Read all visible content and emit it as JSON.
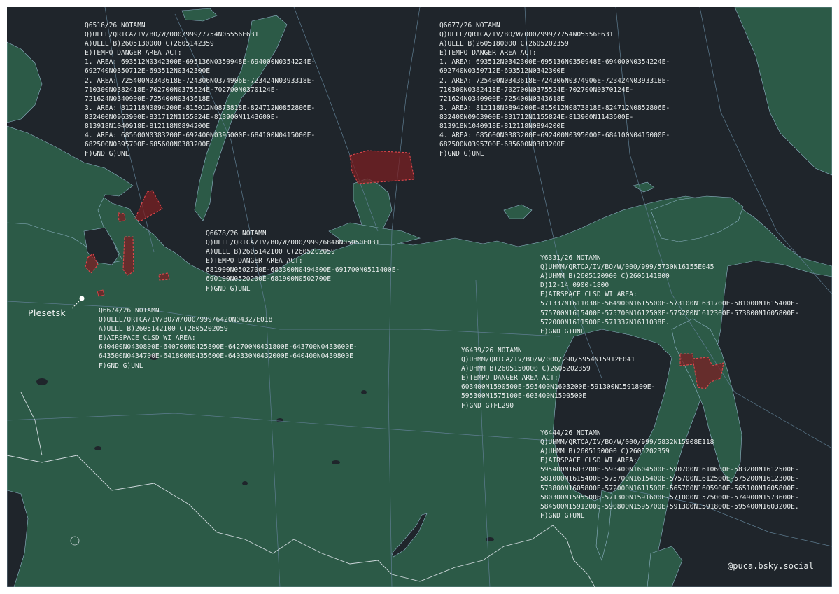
{
  "colors": {
    "sea": "#1f252b",
    "land": "#2c5a47",
    "coast": "#8fb4c6",
    "border": "#cfd8dc",
    "firline": "#5f7e92",
    "zone_fill": "#7a1f23",
    "zone_stroke": "#e0474c",
    "text": "#e8ecec"
  },
  "place": {
    "name": "Plesetsk",
    "icon": "location-dot-icon"
  },
  "credit": "@puca.bsky.social",
  "notams": [
    {
      "id": "q6516",
      "lines": [
        "Q6516/26 NOTAMN",
        "Q)ULLL/QRTCA/IV/BO/W/000/999/7754N05556E631",
        "A)ULLL B)2605130000 C)2605142359",
        "E)TEMPO DANGER AREA ACT:",
        "1. AREA: 693512N0342300E-695136N0350948E-694000N0354224E-",
        "692740N0350712E-693512N0342300E",
        "2. AREA: 725400N0343618E-724306N0374906E-723424N0393318E-",
        "710300N0382418E-702700N0375524E-702700N0370124E-",
        "721624N0340900E-725400N0343618E",
        "3. AREA: 812118N0894200E-815012N0873818E-824712N0852806E-",
        "832400N0963900E-831712N1155824E-813900N1143600E-",
        "813918N1040918E-812118N0894200E",
        "4. AREA: 685600N0383200E-692400N0395000E-684100N0415000E-",
        "682500N0395700E-685600N0383200E",
        "F)GND G)UNL"
      ]
    },
    {
      "id": "q6677",
      "lines": [
        "Q6677/26 NOTAMN",
        "Q)ULLL/QRTCA/IV/BO/W/000/999/7754N05556E631",
        "A)ULLL B)2605180000 C)2605202359",
        "E)TEMPO DANGER AREA ACT:",
        "1. AREA: 693512N0342300E-695136N0350948E-694000N0354224E-",
        "692740N0350712E-693512N0342300E",
        "2. AREA: 725400N0343618E-724306N0374906E-723424N0393318E-",
        "710300N0382418E-702700N0375524E-702700N0370124E-",
        "721624N0340900E-725400N0343618E",
        "3. AREA: 812118N0894200E-815012N0873818E-824712N0852806E-",
        "832400N0963900E-831712N1155824E-813900N1143600E-",
        "813918N1040918E-812118N0894200E",
        "4. AREA: 685600N0383200E-692400N0395000E-684100N0415000E-",
        "682500N0395700E-685600N0383200E",
        "F)GND G)UNL"
      ]
    },
    {
      "id": "q6678",
      "lines": [
        "Q6678/26 NOTAMN",
        "Q)ULLL/QRTCA/IV/BO/W/000/999/6848N05050E031",
        "A)ULLL B)2605142100 C)2605202059",
        "E)TEMPO DANGER AREA ACT:",
        "681900N0502700E-683300N0494800E-691700N0511400E-",
        "690100N0520200E-681900N0502700E",
        "F)GND G)UNL"
      ]
    },
    {
      "id": "q6674",
      "lines": [
        "Q6674/26 NOTAMN",
        "Q)ULLL/QRTCA/IV/BO/W/000/999/6420N04327E018",
        "A)ULLL B)2605142100 C)2605202059",
        "E)AIRSPACE CLSD WI AREA:",
        "640400N0430800E-640700N0425800E-642700N0431800E-643700N0433600E-",
        "643500N0434700E-641800N0435600E-640330N0432000E-640400N0430800E",
        "F)GND G)UNL"
      ]
    },
    {
      "id": "y6331",
      "lines": [
        "Y6331/26 NOTAMN",
        "Q)UHMM/QRTCA/IV/BO/W/000/999/5730N16155E045",
        "A)UHMM B)2605120900 C)2605141800",
        "D)12-14 0900-1800",
        "E)AIRSPACE CLSD WI AREA:",
        "571337N1611038E-564900N1615500E-573100N1631700E-581000N1615400E-",
        "575700N1615400E-575700N1612500E-575200N1612300E-573800N1605800E-",
        "572000N1611500E-571337N1611038E.",
        "F)GND G)UNL"
      ]
    },
    {
      "id": "y6439",
      "lines": [
        "Y6439/26 NOTAMN",
        "Q)UHMM/QRTCA/IV/BO/W/000/290/5954N15912E041",
        "A)UHMM B)2605150000 C)2605202359",
        "E)TEMPO DANGER AREA ACT:",
        "603400N1590500E-595400N1603200E-591300N1591800E-",
        "595300N1575100E-603400N1590500E",
        "F)GND G)FL290"
      ]
    },
    {
      "id": "y6444",
      "lines": [
        "Y6444/26 NOTAMN",
        "Q)UHMM/QRTCA/IV/BO/W/000/999/5832N15908E118",
        "A)UHMM B)2605150000 C)2605202359",
        "E)AIRSPACE CLSD WI AREA:",
        "595400N1603200E-593400N1604500E-590700N1610600E-583200N1612500E-",
        "581000N1615400E-575700N1615400E-575700N1612500E-575200N1612300E-",
        "573800N1605800E-572000N1611500E-565700N1605900E-565100N1605800E-",
        "580300N1595500E-571300N1591600E-571000N1575000E-574900N1573600E-",
        "584500N1591200E-590800N1595700E-591300N1591800E-595400N1603200E.",
        "F)GND G)UNL"
      ]
    }
  ]
}
